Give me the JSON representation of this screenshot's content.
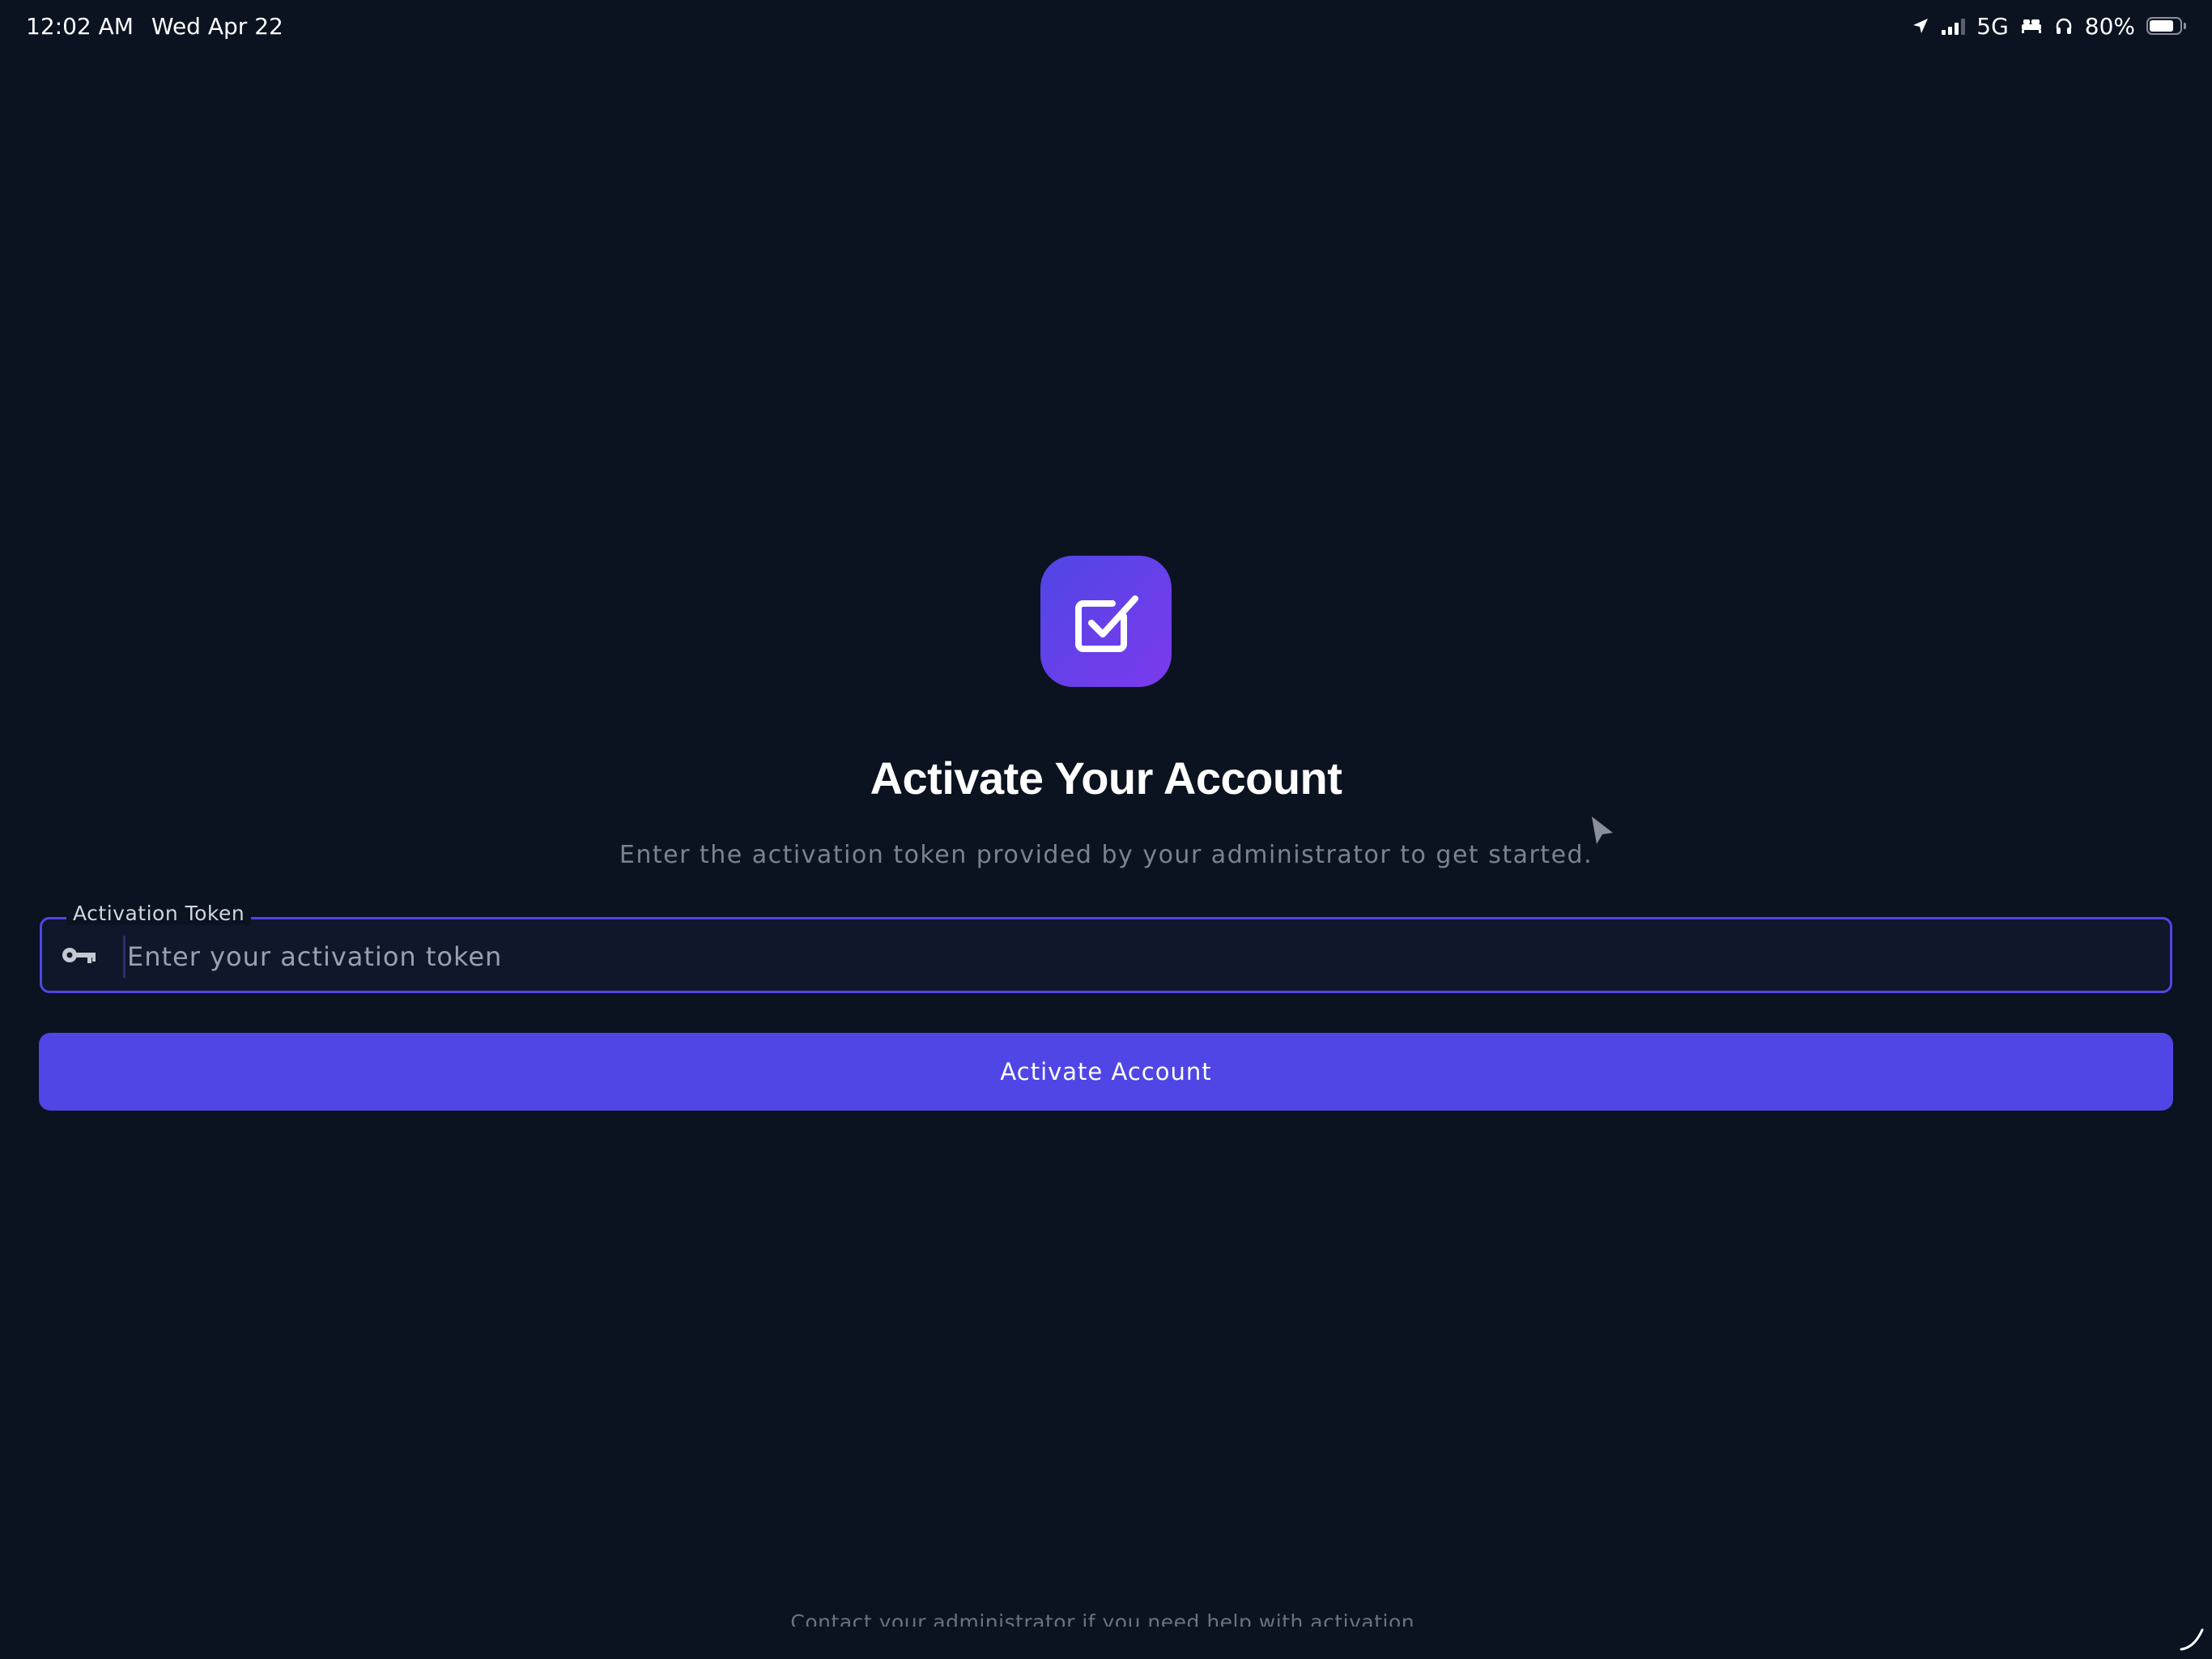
{
  "status_bar": {
    "time": "12:02 AM",
    "date": "Wed Apr 22",
    "network": "5G",
    "battery_percent": "80%",
    "battery_level": 0.8,
    "icons": [
      "location-icon",
      "signal-icon",
      "bed-icon",
      "headphones-icon",
      "battery-icon"
    ]
  },
  "app": {
    "icon": "checkbox-icon",
    "title": "Activate Your Account",
    "subtitle": "Enter the activation token provided by your administrator to get started."
  },
  "token_field": {
    "label": "Activation Token",
    "placeholder": "Enter your activation token",
    "value": "",
    "icon": "key-icon"
  },
  "activate_button": {
    "label": "Activate Account"
  },
  "footer": {
    "help_text": "Contact your administrator if you need help with activation."
  },
  "colors": {
    "background": "#0b1220",
    "accent": "#4f46e5",
    "accent_gradient_end": "#7c3aed",
    "subtitle": "#7b8290"
  }
}
